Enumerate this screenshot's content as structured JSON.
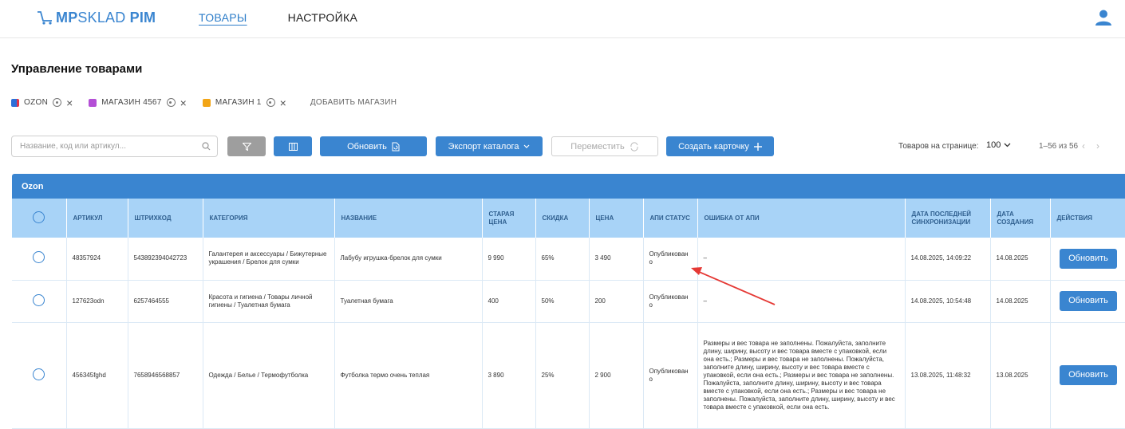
{
  "header": {
    "logo_bold": "MP",
    "logo_light": "SKLAD",
    "logo_suffix": " PIM",
    "nav": [
      {
        "label": "ТОВАРЫ",
        "active": true
      },
      {
        "label": "НАСТРОЙКА",
        "active": false
      }
    ]
  },
  "page": {
    "title": "Управление товарами"
  },
  "shops": {
    "items": [
      {
        "name": "OZON",
        "badge_color": "#2d6fd8"
      },
      {
        "name": "МАГАЗИН 4567",
        "badge_color": "#b44fd6"
      },
      {
        "name": "МАГАЗИН 1",
        "badge_color": "#f2a516"
      }
    ],
    "add_label": "ДОБАВИТЬ МАГАЗИН"
  },
  "toolbar": {
    "search_placeholder": "Название, код или артикул...",
    "refresh_label": "Обновить",
    "export_label": "Экспорт каталога",
    "move_label": "Переместить",
    "create_label": "Создать карточку",
    "per_page_label": "Товаров на странице:",
    "per_page_value": "100",
    "range_label": "1–56 из 56"
  },
  "table": {
    "group": "Ozon",
    "columns": [
      "АРТИКУЛ",
      "ШТРИХКОД",
      "КАТЕГОРИЯ",
      "НАЗВАНИЕ",
      "СТАРАЯ ЦЕНА",
      "СКИДКА",
      "ЦЕНА",
      "АПИ СТАТУС",
      "ОШИБКА ОТ АПИ",
      "ДАТА ПОСЛЕДНЕЙ СИНХРОНИЗАЦИИ",
      "ДАТА СОЗДАНИЯ",
      "ДЕЙСТВИЯ"
    ],
    "action_label": "Обновить",
    "rows": [
      {
        "article": "48357924",
        "barcode": "543892394042723",
        "category": "Галантерея и аксессуары / Бижутерные украшения / Брелок для сумки",
        "name": "Лабубу игрушка-брелок для сумки",
        "old_price": "9 990",
        "discount": "65%",
        "price": "3 490",
        "status": "Опубликован о",
        "error": "–",
        "sync_date": "14.08.2025, 14:09:22",
        "created": "14.08.2025"
      },
      {
        "article": "127623odn",
        "barcode": "6257464555",
        "category": "Красота и гигиена / Товары личной гигиены / Туалетная бумага",
        "name": "Туалетная бумага",
        "old_price": "400",
        "discount": "50%",
        "price": "200",
        "status": "Опубликован о",
        "error": "–",
        "sync_date": "14.08.2025, 10:54:48",
        "created": "14.08.2025"
      },
      {
        "article": "456345fghd",
        "barcode": "7658946568857",
        "category": "Одежда / Белье / Термофутболка",
        "name": "Футболка термо очень теплая",
        "old_price": "3 890",
        "discount": "25%",
        "price": "2 900",
        "status": "Опубликован о",
        "error": "Размеры и вес товара не заполнены. Пожалуйста, заполните длину, ширину, высоту и вес товара вместе с упаковкой, если она есть.; Размеры и вес товара не заполнены. Пожалуйста, заполните длину, ширину, высоту и вес товара вместе с упаковкой, если она есть.; Размеры и вес товара не заполнены. Пожалуйста, заполните длину, ширину, высоту и вес товара вместе с упаковкой, если она есть.; Размеры и вес товара не заполнены. Пожалуйста, заполните длину, ширину, высоту и вес товара вместе с упаковкой, если она есть.",
        "sync_date": "13.08.2025, 11:48:32",
        "created": "13.08.2025"
      }
    ]
  },
  "colors": {
    "accent": "#3a85d0",
    "header_bg": "#a8d3f7",
    "annotation_arrow": "#e53935"
  }
}
